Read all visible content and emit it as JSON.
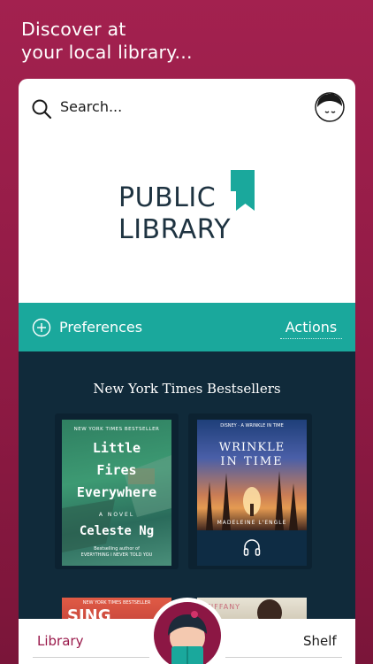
{
  "headline": {
    "line1": "Discover at",
    "line2": "your local library..."
  },
  "search": {
    "placeholder": "Search..."
  },
  "logo": {
    "line1": "PUBLIC",
    "line2": "LIBRARY"
  },
  "toolbar": {
    "preferences_label": "Preferences",
    "actions_label": "Actions"
  },
  "shelf": {
    "title": "New York Times Bestsellers",
    "books": [
      {
        "tag": "NEW YORK TIMES BESTSELLER",
        "title_lines": [
          "Little",
          "Fires",
          "Everywhere"
        ],
        "subtitle": "A NOVEL",
        "author": "Celeste Ng",
        "blurb_lines": [
          "Bestselling author of",
          "EVERYTHING I NEVER TOLD YOU"
        ]
      },
      {
        "top": "DISNEY · A WRINKLE IN TIME",
        "title_line1": "WRINKLE",
        "title_line2": "IN TIME",
        "author": "MADELEINE L'ENGLE",
        "format_icon": "headphones-icon"
      }
    ],
    "row2": [
      {
        "tag": "NEW YORK TIMES BESTSELLER",
        "title": "SING"
      },
      {
        "author_fragment": "TIFFANY"
      }
    ]
  },
  "tabs": {
    "library_label": "Library",
    "shelf_label": "Shelf"
  },
  "colors": {
    "brand": "#a3214f",
    "teal": "#1aa89c",
    "navy": "#102a3a"
  }
}
